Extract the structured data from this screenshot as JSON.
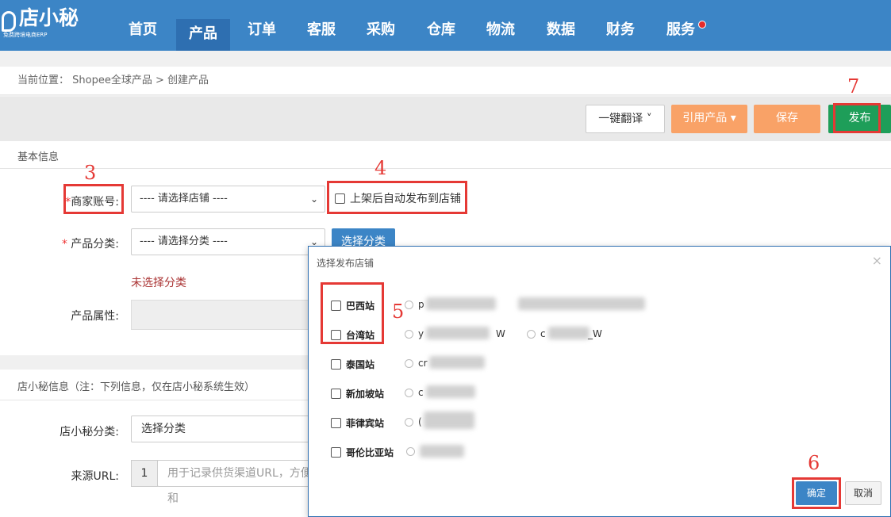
{
  "header": {
    "logo_name": "店小秘",
    "logo_slogan": "免费跨境电商ERP",
    "nav": [
      {
        "label": "首页"
      },
      {
        "label": "产品"
      },
      {
        "label": "订单"
      },
      {
        "label": "客服"
      },
      {
        "label": "采购"
      },
      {
        "label": "仓库"
      },
      {
        "label": "物流"
      },
      {
        "label": "数据"
      },
      {
        "label": "财务"
      },
      {
        "label": "服务"
      }
    ],
    "active_nav": "产品"
  },
  "breadcrumb": "当前位置： Shopee全球产品 > 创建产品",
  "toolbar": {
    "translate": "一键翻译 ˅",
    "quote": "引用产品 ▾",
    "save": "保存",
    "publish": "发布"
  },
  "basic": {
    "title": "基本信息",
    "merchant_label": "商家账号:",
    "merchant_required": "*",
    "merchant_select": "---- 请选择店铺 ----",
    "auto_publish": "上架后自动发布到店铺",
    "category_label": "产品分类:",
    "category_required": "* ",
    "category_select": "---- 请选择分类 ----",
    "choose_category": "选择分类",
    "no_category": "未选择分类",
    "attr_label": "产品属性:"
  },
  "dxm": {
    "title": "店小秘信息（注：下列信息，仅在店小秘系统生效）",
    "cat_label": "店小秘分类:",
    "cat_value": "选择分类",
    "url_label": "来源URL:",
    "url_addon": "1",
    "url_placeholder": "用于记录供货渠道URL，方便和"
  },
  "modal": {
    "title": "选择发布店铺",
    "close": "×",
    "sites": [
      {
        "label": "巴西站",
        "store_prefix": "p"
      },
      {
        "label": "台湾站",
        "store_prefix": "y",
        "store_suffix": "W",
        "store2_prefix": "c",
        "store2_suffix": "_W"
      },
      {
        "label": "泰国站",
        "store_prefix": "cr"
      },
      {
        "label": "新加坡站",
        "store_prefix": "c"
      },
      {
        "label": "菲律宾站",
        "store_prefix": "("
      },
      {
        "label": "哥伦比亚站",
        "store_prefix": ""
      }
    ],
    "ok": "确定",
    "cancel": "取消"
  },
  "annotations": [
    "3",
    "4",
    "5",
    "6",
    "7"
  ],
  "colors": {
    "nav_bg": "#3c85c6",
    "publish": "#1e9e59",
    "orange": "#f9a267",
    "annotation": "#e53935"
  }
}
